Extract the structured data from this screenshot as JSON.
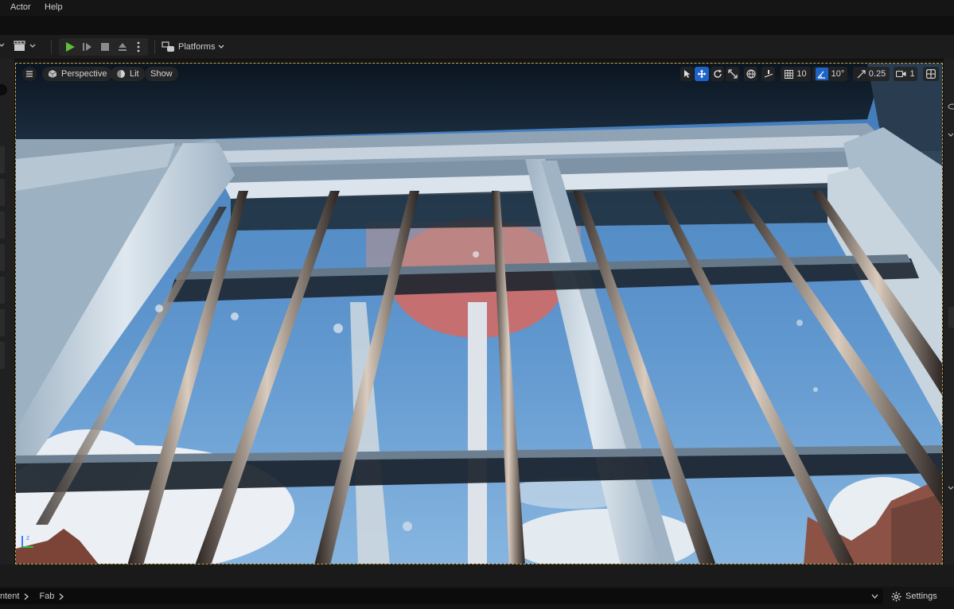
{
  "menu": {
    "items": [
      "Actor",
      "Help"
    ]
  },
  "toolbar": {
    "platforms_label": "Platforms",
    "play_color": "#5fbd3a"
  },
  "viewport": {
    "view_mode": "Perspective",
    "lighting_mode": "Lit",
    "show_label": "Show",
    "grid_snap_value": "10",
    "rotation_snap_value": "10°",
    "scale_snap_value": "0.25",
    "camera_speed_value": "1",
    "accent_color": "#1f63c7"
  },
  "content_browser": {
    "breadcrumb": [
      "ntent",
      "Fab"
    ],
    "settings_label": "Settings"
  }
}
